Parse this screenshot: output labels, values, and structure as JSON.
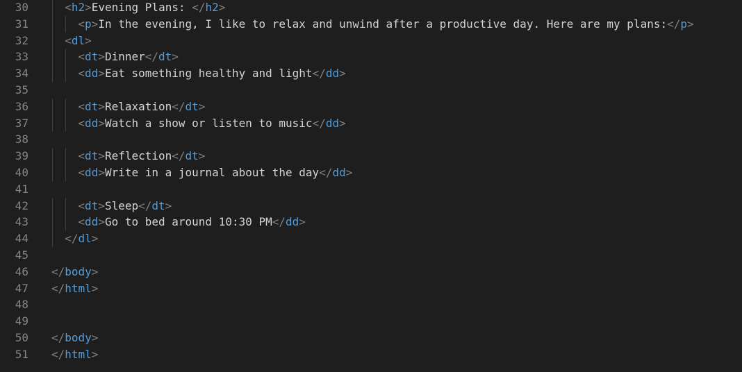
{
  "editor": {
    "lines": [
      {
        "num": "30",
        "indent": 1,
        "tokens": [
          {
            "t": "b",
            "v": "<"
          },
          {
            "t": "g",
            "v": "h2"
          },
          {
            "t": "b",
            "v": ">"
          },
          {
            "t": "x",
            "v": "Evening Plans: "
          },
          {
            "t": "b",
            "v": "</"
          },
          {
            "t": "g",
            "v": "h2"
          },
          {
            "t": "b",
            "v": ">"
          }
        ]
      },
      {
        "num": "31",
        "indent": 2,
        "tokens": [
          {
            "t": "b",
            "v": "<"
          },
          {
            "t": "g",
            "v": "p"
          },
          {
            "t": "b",
            "v": ">"
          },
          {
            "t": "x",
            "v": "In the evening, I like to relax and unwind after a productive day. Here are my plans:"
          },
          {
            "t": "b",
            "v": "</"
          },
          {
            "t": "g",
            "v": "p"
          },
          {
            "t": "b",
            "v": ">"
          }
        ]
      },
      {
        "num": "32",
        "indent": 1,
        "tokens": [
          {
            "t": "b",
            "v": "<"
          },
          {
            "t": "g",
            "v": "dl"
          },
          {
            "t": "b",
            "v": ">"
          }
        ]
      },
      {
        "num": "33",
        "indent": 2,
        "tokens": [
          {
            "t": "b",
            "v": "<"
          },
          {
            "t": "g",
            "v": "dt"
          },
          {
            "t": "b",
            "v": ">"
          },
          {
            "t": "x",
            "v": "Dinner"
          },
          {
            "t": "b",
            "v": "</"
          },
          {
            "t": "g",
            "v": "dt"
          },
          {
            "t": "b",
            "v": ">"
          }
        ]
      },
      {
        "num": "34",
        "indent": 2,
        "tokens": [
          {
            "t": "b",
            "v": "<"
          },
          {
            "t": "g",
            "v": "dd"
          },
          {
            "t": "b",
            "v": ">"
          },
          {
            "t": "x",
            "v": "Eat something healthy and light"
          },
          {
            "t": "b",
            "v": "</"
          },
          {
            "t": "g",
            "v": "dd"
          },
          {
            "t": "b",
            "v": ">"
          }
        ]
      },
      {
        "num": "35",
        "indent": 0,
        "tokens": []
      },
      {
        "num": "36",
        "indent": 2,
        "tokens": [
          {
            "t": "b",
            "v": "<"
          },
          {
            "t": "g",
            "v": "dt"
          },
          {
            "t": "b",
            "v": ">"
          },
          {
            "t": "x",
            "v": "Relaxation"
          },
          {
            "t": "b",
            "v": "</"
          },
          {
            "t": "g",
            "v": "dt"
          },
          {
            "t": "b",
            "v": ">"
          }
        ]
      },
      {
        "num": "37",
        "indent": 2,
        "tokens": [
          {
            "t": "b",
            "v": "<"
          },
          {
            "t": "g",
            "v": "dd"
          },
          {
            "t": "b",
            "v": ">"
          },
          {
            "t": "x",
            "v": "Watch a show or listen to music"
          },
          {
            "t": "b",
            "v": "</"
          },
          {
            "t": "g",
            "v": "dd"
          },
          {
            "t": "b",
            "v": ">"
          }
        ]
      },
      {
        "num": "38",
        "indent": 0,
        "tokens": []
      },
      {
        "num": "39",
        "indent": 2,
        "tokens": [
          {
            "t": "b",
            "v": "<"
          },
          {
            "t": "g",
            "v": "dt"
          },
          {
            "t": "b",
            "v": ">"
          },
          {
            "t": "x",
            "v": "Reflection"
          },
          {
            "t": "b",
            "v": "</"
          },
          {
            "t": "g",
            "v": "dt"
          },
          {
            "t": "b",
            "v": ">"
          }
        ]
      },
      {
        "num": "40",
        "indent": 2,
        "tokens": [
          {
            "t": "b",
            "v": "<"
          },
          {
            "t": "g",
            "v": "dd"
          },
          {
            "t": "b",
            "v": ">"
          },
          {
            "t": "x",
            "v": "Write in a journal about the day"
          },
          {
            "t": "b",
            "v": "</"
          },
          {
            "t": "g",
            "v": "dd"
          },
          {
            "t": "b",
            "v": ">"
          }
        ]
      },
      {
        "num": "41",
        "indent": 0,
        "tokens": []
      },
      {
        "num": "42",
        "indent": 2,
        "tokens": [
          {
            "t": "b",
            "v": "<"
          },
          {
            "t": "g",
            "v": "dt"
          },
          {
            "t": "b",
            "v": ">"
          },
          {
            "t": "x",
            "v": "Sleep"
          },
          {
            "t": "b",
            "v": "</"
          },
          {
            "t": "g",
            "v": "dt"
          },
          {
            "t": "b",
            "v": ">"
          }
        ]
      },
      {
        "num": "43",
        "indent": 2,
        "tokens": [
          {
            "t": "b",
            "v": "<"
          },
          {
            "t": "g",
            "v": "dd"
          },
          {
            "t": "b",
            "v": ">"
          },
          {
            "t": "x",
            "v": "Go to bed around 10:30 PM"
          },
          {
            "t": "b",
            "v": "</"
          },
          {
            "t": "g",
            "v": "dd"
          },
          {
            "t": "b",
            "v": ">"
          }
        ]
      },
      {
        "num": "44",
        "indent": 1,
        "tokens": [
          {
            "t": "b",
            "v": "</"
          },
          {
            "t": "g",
            "v": "dl"
          },
          {
            "t": "b",
            "v": ">"
          }
        ]
      },
      {
        "num": "45",
        "indent": 0,
        "tokens": []
      },
      {
        "num": "46",
        "indent": 0,
        "tokens": [
          {
            "t": "b",
            "v": "</"
          },
          {
            "t": "g",
            "v": "body"
          },
          {
            "t": "b",
            "v": ">"
          }
        ]
      },
      {
        "num": "47",
        "indent": 0,
        "tokens": [
          {
            "t": "b",
            "v": "</"
          },
          {
            "t": "g",
            "v": "html"
          },
          {
            "t": "b",
            "v": ">"
          }
        ]
      },
      {
        "num": "48",
        "indent": 0,
        "tokens": []
      },
      {
        "num": "49",
        "indent": 0,
        "tokens": []
      },
      {
        "num": "50",
        "indent": 0,
        "tokens": [
          {
            "t": "b",
            "v": "</"
          },
          {
            "t": "g",
            "v": "body"
          },
          {
            "t": "b",
            "v": ">"
          }
        ]
      },
      {
        "num": "51",
        "indent": 0,
        "tokens": [
          {
            "t": "b",
            "v": "</"
          },
          {
            "t": "g",
            "v": "html"
          },
          {
            "t": "b",
            "v": ">"
          }
        ]
      }
    ]
  },
  "colors": {
    "background": "#1e1e1e",
    "line_number": "#858585",
    "bracket": "#808080",
    "tag": "#569cd6",
    "text": "#d4d4d4",
    "indent_guide": "#404040"
  }
}
